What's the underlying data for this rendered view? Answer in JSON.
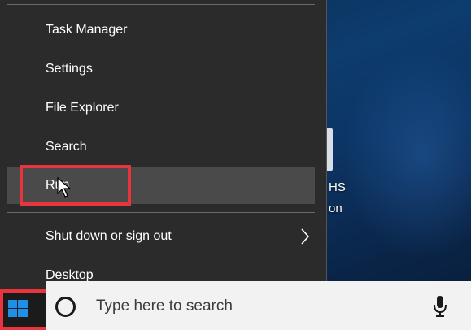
{
  "context_menu": {
    "items": [
      {
        "label": "Task Manager"
      },
      {
        "label": "Settings"
      },
      {
        "label": "File Explorer"
      },
      {
        "label": "Search"
      },
      {
        "label": "Run"
      },
      {
        "label": "Shut down or sign out"
      },
      {
        "label": "Desktop"
      }
    ]
  },
  "desktop": {
    "icon_text_line1": "HS",
    "icon_text_line2": "on"
  },
  "taskbar": {
    "search_placeholder": "Type here to search",
    "start_icon": "windows-logo-icon",
    "search_icon": "cortana-circle-icon",
    "mic_icon": "microphone-icon"
  },
  "colors": {
    "menu_bg": "#2b2b2b",
    "menu_hover": "#4a4a4a",
    "highlight": "#e8343d",
    "windows_blue": "#1e90e8"
  }
}
